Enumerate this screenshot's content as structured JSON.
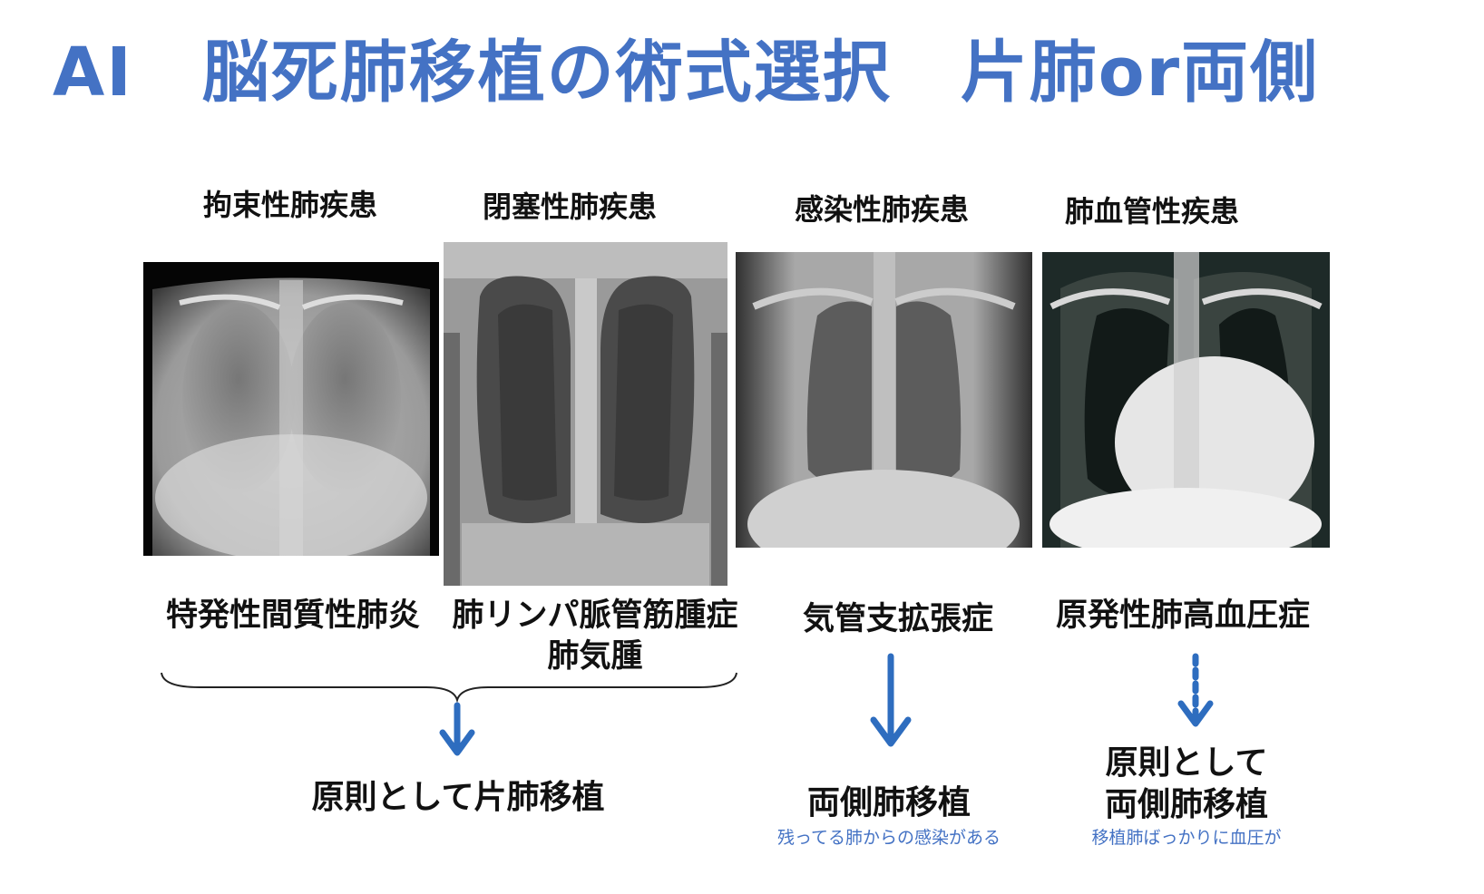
{
  "title": "AI　脳死肺移植の術式選択　片肺or両側",
  "columns": [
    {
      "category": "拘束性肺疾患",
      "disease": "特発性間質性肺炎"
    },
    {
      "category": "閉塞性肺疾患",
      "disease_lines": [
        "肺リンパ脈管筋腫症",
        "肺気腫"
      ]
    },
    {
      "category": "感染性肺疾患",
      "disease": "気管支拡張症",
      "result": "両側肺移植",
      "note": "残ってる肺からの感染がある"
    },
    {
      "category": "肺血管性疾患",
      "disease": "原発性肺高血圧症",
      "result_lines": [
        "原則として",
        "両側肺移植"
      ],
      "note": "移植肺ばっかりに血圧が"
    }
  ],
  "group_result": "原則として片肺移植",
  "colors": {
    "accent": "#4472c4",
    "arrow": "#2e6dbf",
    "text": "#111111"
  }
}
